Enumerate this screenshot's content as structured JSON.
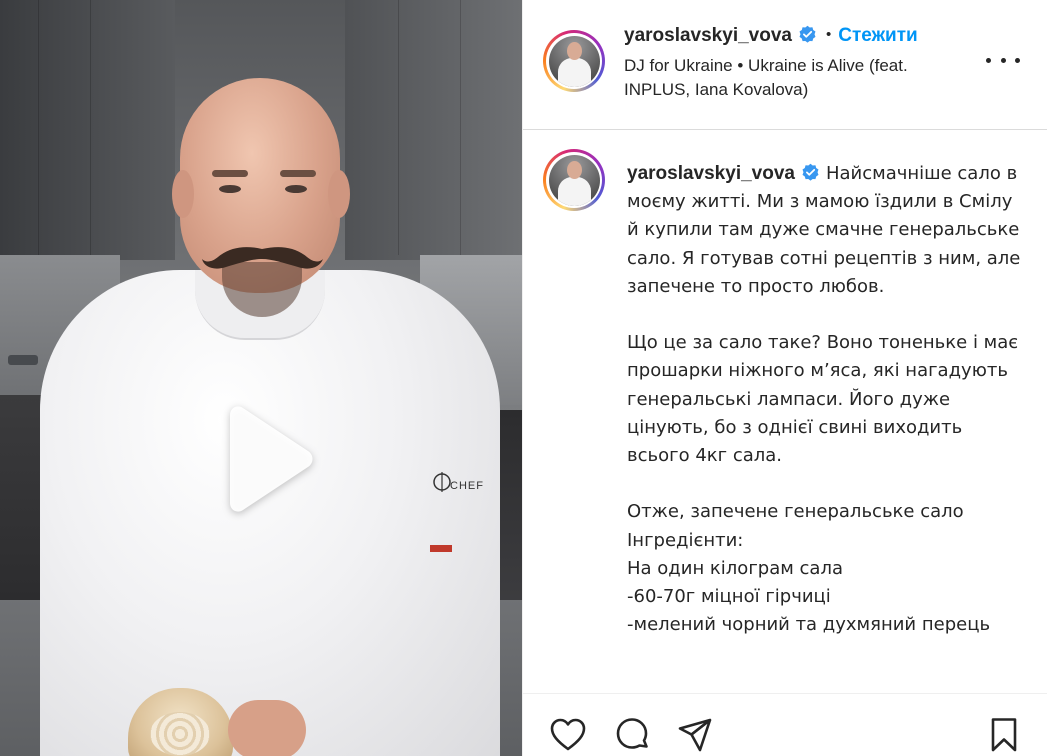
{
  "post": {
    "author": {
      "username": "yaroslavskyi_vova",
      "verified_icon": "verified-badge-icon",
      "verified_color": "#3897f0"
    },
    "follow_label": "Стежити",
    "separator": "•",
    "audio_label": "DJ for Ukraine • Ukraine is Alive (feat. INPLUS, Iana Kovalova)",
    "more_icon": "more-options-icon"
  },
  "media": {
    "type": "video",
    "play_icon": "play-icon",
    "jacket_patch_text": "CHEF"
  },
  "caption": {
    "username": "yaroslavskyi_vova",
    "paragraphs": [
      "Найсмачніше сало в моєму житті. Ми з мамою їздили в Смілу й купили там дуже смачне генеральське сало. Я готував сотні рецептів з ним, але запечене то просто любов.",
      "Що це за сало таке? Воно тоненьке і має прошарки ніжного м’яса, які нагадують генеральські лампаси. Його дуже цінують, бо з однієї свині виходить всього 4кг сала."
    ],
    "recipe_lines": [
      "Отже, запечене генеральське сало",
      "Інгредієнти:",
      "На один кілограм сала",
      "-60-70г міцної гірчиці",
      "-мелений чорний та духмяний перець"
    ]
  },
  "actions": [
    {
      "icon": "heart-icon"
    },
    {
      "icon": "comment-icon"
    },
    {
      "icon": "share-icon"
    },
    {
      "icon": "save-bookmark-icon"
    }
  ],
  "colors": {
    "link_blue": "#0095f6",
    "text": "#262626",
    "divider": "#dbdbdb"
  }
}
